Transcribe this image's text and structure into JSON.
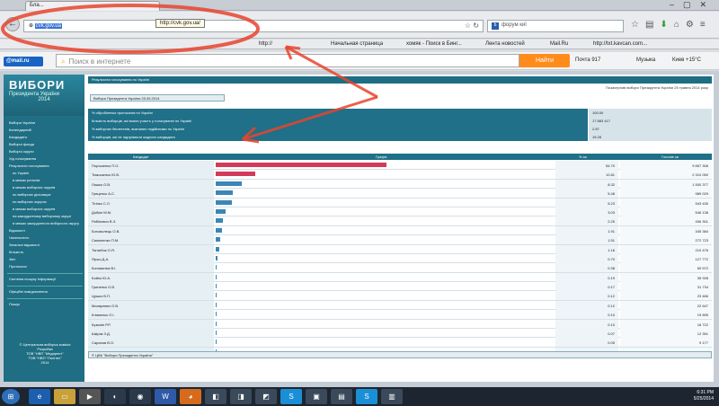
{
  "browser": {
    "tab_title": "Бла...",
    "url_host": "cvk.gov.ua",
    "url_tooltip": "http://cvk.gov.ua/",
    "search_placeholder": "форум киї",
    "bookmarks": [
      "http://",
      "Начальная страница",
      "хомяк - Поиск в Бинг...",
      "Лента новостей",
      "Mail.Ru",
      "http://txt.kavcan.com..."
    ]
  },
  "mailru": {
    "logo": "@mail.ru",
    "search_placeholder": "Поиск в интернете",
    "find_button": "Найти",
    "mail_label": "Почта 917",
    "music_label": "Музыка",
    "weather": "Киев +15°C"
  },
  "sidebar": {
    "title": "ВИБОРИ",
    "subtitle": "Президента України",
    "year": "2014",
    "items": [
      "Вибори України",
      "Календарний",
      "Кандидати",
      "Виборчі фонди",
      "Виборчі округи",
      "Хід голосування",
      "Результати голосування",
      "по Україні",
      "в межах регіонів",
      "в межах виборчих округів",
      "по виборчих дільницях",
      "по виборчих округах",
      "в межах виборчих округів",
      "на закордонному виборчому окрузі",
      "в межах закордонного виборчого округу",
      "Відомості",
      "Чисельність",
      "Загальні відомості",
      "Кількість",
      "Звіт",
      "Протоколи"
    ],
    "items_extra": [
      "Система пошуку інформації",
      "Офіційні повідомлення",
      "Пошук"
    ],
    "footer_lines": [
      "© Центральна виборча комісія",
      "Розробка",
      "ТОВ \"НВП \"Медирент\"",
      "ТОВ \"НВП \"Політех\"",
      "2014"
    ]
  },
  "main": {
    "breadcrumb": "Результати голосування по Україні",
    "meta_right": "Позачергові вибори Президента України 25 травня 2014 року",
    "subhead": "Вибори Президента України 25.05.2014",
    "stats": [
      {
        "label": "% обробленых протоколів по Україні",
        "value": "100.00"
      },
      {
        "label": "Кількість виборців, які взяли участь у голосуванні по Україні",
        "value": "17 883 417"
      },
      {
        "label": "% виборчих бюлетенів, визнаних недійсними по Україні",
        "value": "2.87"
      },
      {
        "label": "% виборців, які не підтримали жодного кандидата",
        "value": "15.28"
      }
    ],
    "table_headers": {
      "candidate": "Кандидат",
      "chart": "Графік",
      "pct": "% за",
      "votes": "Голосів за"
    },
    "copyright": "© ЦВК \"Вибори Президента України\"",
    "candidates": [
      {
        "name": "Порошенко П.О.",
        "pct": 54.7,
        "pct_text": "54.70",
        "votes": "9 857 308",
        "color": "#d33a5a"
      },
      {
        "name": "Тимошенко Ю.В.",
        "pct": 12.81,
        "pct_text": "12.81",
        "votes": "2 310 050",
        "color": "#d33a5a"
      },
      {
        "name": "Ляшко О.В.",
        "pct": 8.32,
        "pct_text": "8.32",
        "votes": "1 500 377",
        "color": "#3a87b5"
      },
      {
        "name": "Гриценко А.С.",
        "pct": 5.48,
        "pct_text": "5.48",
        "votes": "989 029",
        "color": "#3a87b5"
      },
      {
        "name": "Тігіпко С.Л.",
        "pct": 5.23,
        "pct_text": "5.23",
        "votes": "943 430",
        "color": "#3a87b5"
      },
      {
        "name": "Добкін М.М.",
        "pct": 3.03,
        "pct_text": "3.03",
        "votes": "546 138",
        "color": "#3a87b5"
      },
      {
        "name": "Рабінович В.З.",
        "pct": 2.25,
        "pct_text": "2.25",
        "votes": "406 301",
        "color": "#3a87b5"
      },
      {
        "name": "Богомолець О.В.",
        "pct": 1.91,
        "pct_text": "1.91",
        "votes": "345 384",
        "color": "#3a87b5"
      },
      {
        "name": "Симоненко П.М.",
        "pct": 1.51,
        "pct_text": "1.51",
        "votes": "272 723",
        "color": "#3a87b5"
      },
      {
        "name": "Тягнибок О.Я.",
        "pct": 1.16,
        "pct_text": "1.16",
        "votes": "210 476",
        "color": "#3a87b5"
      },
      {
        "name": "Ярош Д.А.",
        "pct": 0.7,
        "pct_text": "0.70",
        "votes": "127 772",
        "color": "#3a87b5"
      },
      {
        "name": "Коновалюк В.І.",
        "pct": 0.38,
        "pct_text": "0.38",
        "votes": "69 572",
        "color": "#3a87b5"
      },
      {
        "name": "Бойко Ю.А.",
        "pct": 0.19,
        "pct_text": "0.19",
        "votes": "35 928",
        "color": "#3a87b5"
      },
      {
        "name": "Гриненко О.В.",
        "pct": 0.17,
        "pct_text": "0.17",
        "votes": "31 734",
        "color": "#3a87b5"
      },
      {
        "name": "Цушко В.П.",
        "pct": 0.12,
        "pct_text": "0.12",
        "votes": "23 466",
        "color": "#3a87b5"
      },
      {
        "name": "Маляревич О.В.",
        "pct": 0.12,
        "pct_text": "0.12",
        "votes": "22 647",
        "color": "#3a87b5"
      },
      {
        "name": "Клименко О.І.",
        "pct": 0.1,
        "pct_text": "0.10",
        "votes": "19 895",
        "color": "#3a87b5"
      },
      {
        "name": "Кузьмін Р.Р.",
        "pct": 0.1,
        "pct_text": "0.10",
        "votes": "18 722",
        "color": "#3a87b5"
      },
      {
        "name": "Шкіряк З.Д.",
        "pct": 0.07,
        "pct_text": "0.07",
        "votes": "12 391",
        "color": "#3a87b5"
      },
      {
        "name": "Саранов В.О.",
        "pct": 0.05,
        "pct_text": "0.05",
        "votes": "9 177",
        "color": "#3a87b5"
      },
      {
        "name": "Куйбіда В.С.",
        "pct": 0.04,
        "pct_text": "0.04",
        "votes": "7 923",
        "color": "#3a87b5"
      }
    ]
  },
  "taskbar": {
    "time": "6:31 PM",
    "date": "5/25/2014"
  }
}
